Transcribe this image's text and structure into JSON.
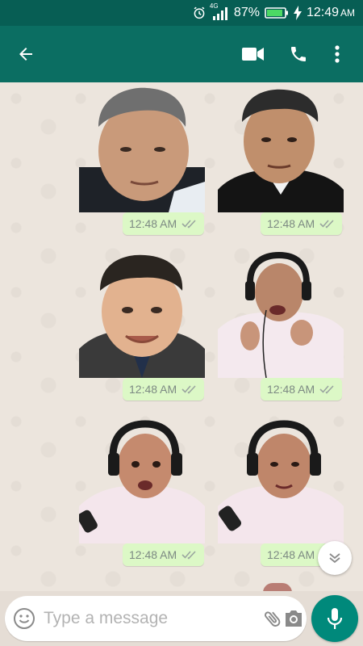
{
  "status_bar": {
    "network": "4G",
    "battery": "87%",
    "time": "12:49",
    "ampm": "AM"
  },
  "messages": [
    {
      "time": "12:48 AM"
    },
    {
      "time": "12:48 AM"
    },
    {
      "time": "12:48 AM"
    },
    {
      "time": "12:48 AM"
    },
    {
      "time": "12:48 AM"
    },
    {
      "time": "12:48 AM"
    }
  ],
  "composer": {
    "placeholder": "Type a message"
  },
  "colors": {
    "header": "#0b6e62",
    "status_bar": "#075e54",
    "bubble": "#dcf8c6",
    "fab": "#00897b"
  }
}
